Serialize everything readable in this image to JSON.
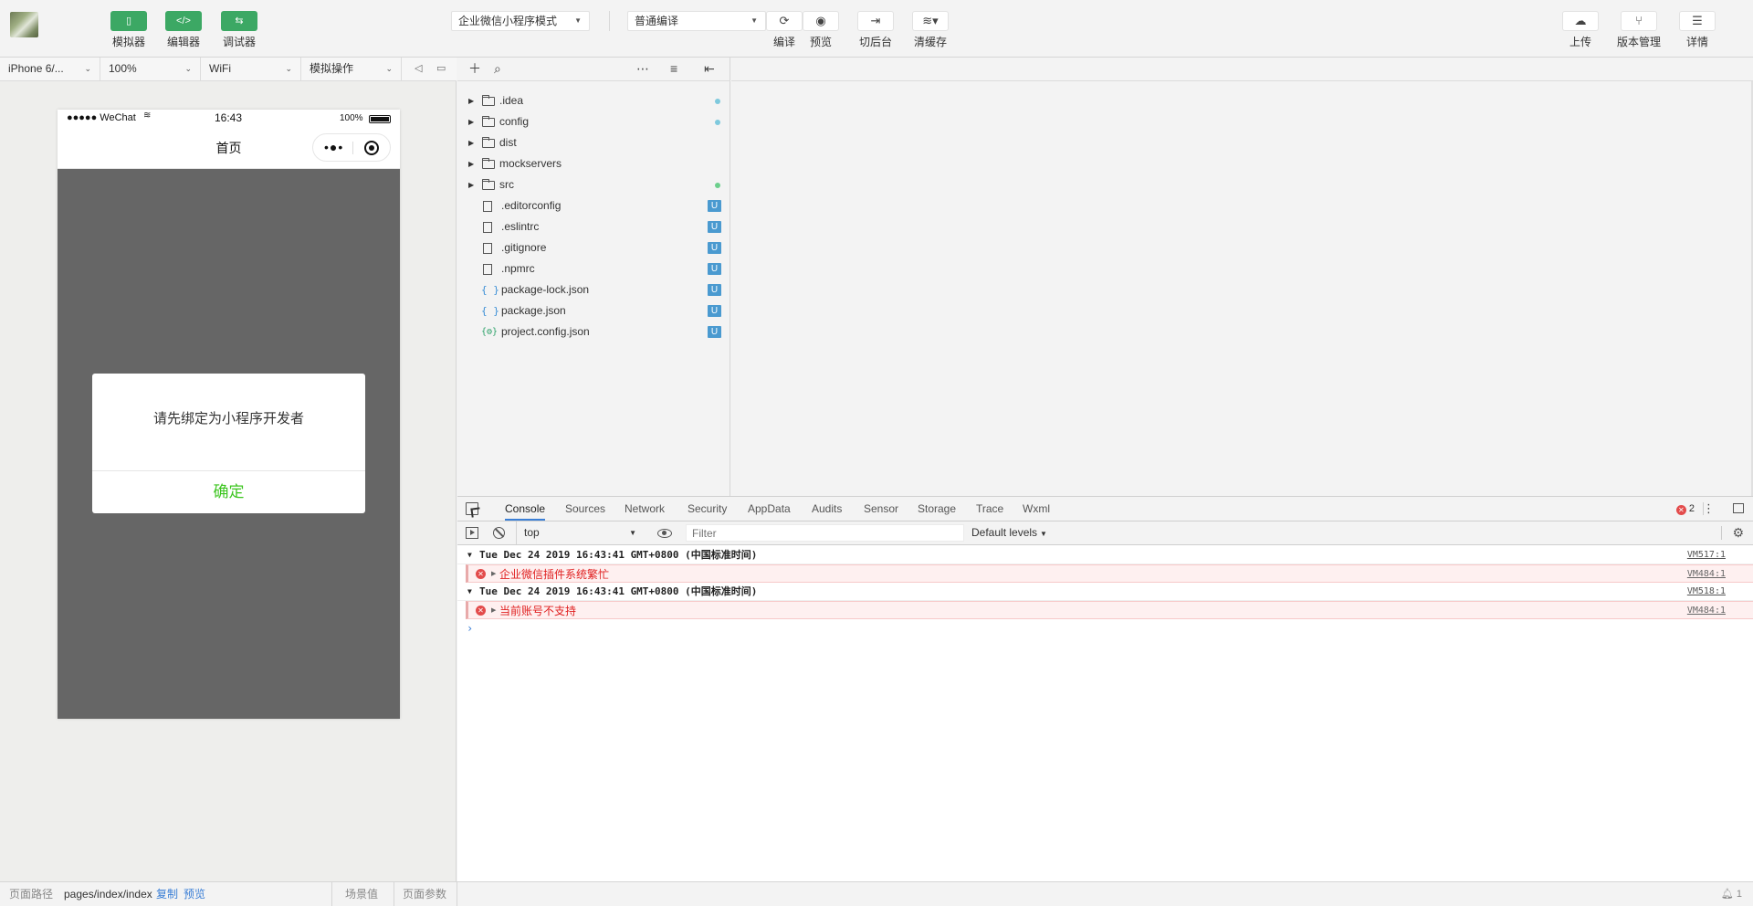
{
  "toolbar": {
    "simulator": {
      "label": "模拟器",
      "icon": "phone-icon"
    },
    "editor": {
      "label": "编辑器",
      "icon": "code-icon"
    },
    "debugger": {
      "label": "调试器",
      "icon": "swap-icon"
    },
    "mode_select": "企业微信小程序模式",
    "compile_select": "普通编译",
    "compile": {
      "label": "编译",
      "icon": "refresh-icon"
    },
    "preview": {
      "label": "预览",
      "icon": "eye-icon"
    },
    "background": {
      "label": "切后台",
      "icon": "arrow-right-bar-icon"
    },
    "clear_cache": {
      "label": "清缓存",
      "icon": "layers-icon"
    },
    "upload": {
      "label": "上传",
      "icon": "cloud-upload-icon"
    },
    "version": {
      "label": "版本管理",
      "icon": "branch-icon"
    },
    "details": {
      "label": "详情",
      "icon": "menu-icon"
    }
  },
  "simbar": {
    "device": "iPhone 6/...",
    "zoom": "100%",
    "network": "WiFi",
    "operation": "模拟操作"
  },
  "phone": {
    "carrier": "●●●●● WeChat",
    "time": "16:43",
    "battery": "100%",
    "nav_title": "首页",
    "modal_message": "请先绑定为小程序开发者",
    "modal_confirm": "确定"
  },
  "tree": {
    "folders": [
      {
        "name": ".idea",
        "marker": "dot-blue"
      },
      {
        "name": "config",
        "marker": "dot-blue"
      },
      {
        "name": "dist",
        "marker": ""
      },
      {
        "name": "mockservers",
        "marker": ""
      },
      {
        "name": "src",
        "marker": "dot-green"
      }
    ],
    "files": [
      {
        "name": ".editorconfig",
        "icon": "file-icon",
        "badge": "U"
      },
      {
        "name": ".eslintrc",
        "icon": "file-icon",
        "badge": "U"
      },
      {
        "name": ".gitignore",
        "icon": "file-icon",
        "badge": "U"
      },
      {
        "name": ".npmrc",
        "icon": "file-icon",
        "badge": "U"
      },
      {
        "name": "package-lock.json",
        "icon": "json-icon",
        "badge": "U"
      },
      {
        "name": "package.json",
        "icon": "json-icon",
        "badge": "U"
      },
      {
        "name": "project.config.json",
        "icon": "config-json-icon",
        "badge": "U"
      }
    ]
  },
  "devtools": {
    "tabs": [
      "Console",
      "Sources",
      "Network",
      "Security",
      "AppData",
      "Audits",
      "Sensor",
      "Storage",
      "Trace",
      "Wxml"
    ],
    "active_tab": "Console",
    "error_count": "2",
    "context": "top",
    "filter_placeholder": "Filter",
    "levels": "Default levels",
    "logs": [
      {
        "header": "Tue Dec 24 2019 16:43:41 GMT+0800 (中国标准时间)",
        "header_src": "VM517:1",
        "message": "企业微信插件系统繁忙",
        "message_src": "VM484:1"
      },
      {
        "header": "Tue Dec 24 2019 16:43:41 GMT+0800 (中国标准时间)",
        "header_src": "VM518:1",
        "message": "当前账号不支持",
        "message_src": "VM484:1"
      }
    ],
    "prompt": "›"
  },
  "footer": {
    "path_label": "页面路径",
    "path": "pages/index/index",
    "copy": "复制",
    "preview": "预览",
    "scene": "场景值",
    "params": "页面参数",
    "notifications": "1"
  },
  "colors": {
    "accent_green": "#3ca864",
    "confirm_green": "#3cc51f",
    "error_red": "#e01f1f",
    "badge_blue": "#4a9ad0",
    "phone_mask": "#666666"
  }
}
